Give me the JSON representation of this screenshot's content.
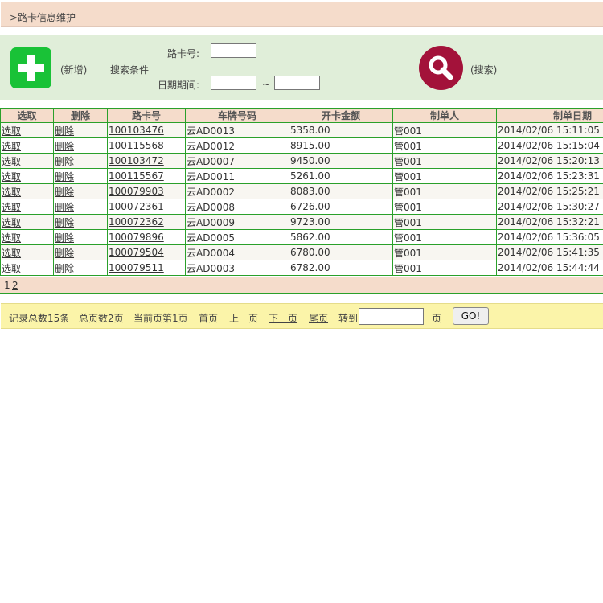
{
  "header": {
    "title": ">路卡信息维护"
  },
  "toolbar": {
    "add_label": "(新增)",
    "search_section_label": "搜索条件",
    "card_no_label": "路卡号:",
    "card_no_value": "",
    "date_range_label": "日期期间:",
    "date_from_value": "",
    "date_separator": "~",
    "date_to_value": "",
    "search_label": "(搜索)",
    "colors": {
      "add_button": "#19c237",
      "search_button": "#a3123a"
    }
  },
  "table": {
    "columns": [
      "选取",
      "删除",
      "路卡号",
      "车牌号码",
      "开卡金额",
      "制单人",
      "制单日期"
    ],
    "rows": [
      {
        "select": "选取",
        "delete": "删除",
        "card_no": "100103476",
        "plate": "云AD0013",
        "amount": "5358.00",
        "creator": "管001",
        "date": "2014/02/06 15:11:05"
      },
      {
        "select": "选取",
        "delete": "删除",
        "card_no": "100115568",
        "plate": "云AD0012",
        "amount": "8915.00",
        "creator": "管001",
        "date": "2014/02/06 15:15:04"
      },
      {
        "select": "选取",
        "delete": "删除",
        "card_no": "100103472",
        "plate": "云AD0007",
        "amount": "9450.00",
        "creator": "管001",
        "date": "2014/02/06 15:20:13"
      },
      {
        "select": "选取",
        "delete": "删除",
        "card_no": "100115567",
        "plate": "云AD0011",
        "amount": "5261.00",
        "creator": "管001",
        "date": "2014/02/06 15:23:31"
      },
      {
        "select": "选取",
        "delete": "删除",
        "card_no": "100079903",
        "plate": "云AD0002",
        "amount": "8083.00",
        "creator": "管001",
        "date": "2014/02/06 15:25:21"
      },
      {
        "select": "选取",
        "delete": "删除",
        "card_no": "100072361",
        "plate": "云AD0008",
        "amount": "6726.00",
        "creator": "管001",
        "date": "2014/02/06 15:30:27"
      },
      {
        "select": "选取",
        "delete": "删除",
        "card_no": "100072362",
        "plate": "云AD0009",
        "amount": "9723.00",
        "creator": "管001",
        "date": "2014/02/06 15:32:21"
      },
      {
        "select": "选取",
        "delete": "删除",
        "card_no": "100079896",
        "plate": "云AD0005",
        "amount": "5862.00",
        "creator": "管001",
        "date": "2014/02/06 15:36:05"
      },
      {
        "select": "选取",
        "delete": "删除",
        "card_no": "100079504",
        "plate": "云AD0004",
        "amount": "6780.00",
        "creator": "管001",
        "date": "2014/02/06 15:41:35"
      },
      {
        "select": "选取",
        "delete": "删除",
        "card_no": "100079511",
        "plate": "云AD0003",
        "amount": "6782.00",
        "creator": "管001",
        "date": "2014/02/06 15:44:44"
      }
    ]
  },
  "pager": {
    "pages": [
      "1",
      "2"
    ]
  },
  "footer": {
    "total_records": "记录总数15条",
    "total_pages": "总页数2页",
    "current_page": "当前页第1页",
    "first": "首页",
    "prev": "上一页",
    "next": "下一页",
    "last": "尾页",
    "goto_label": "转到",
    "goto_value": "",
    "page_unit": "页",
    "go_button": "GO!"
  }
}
